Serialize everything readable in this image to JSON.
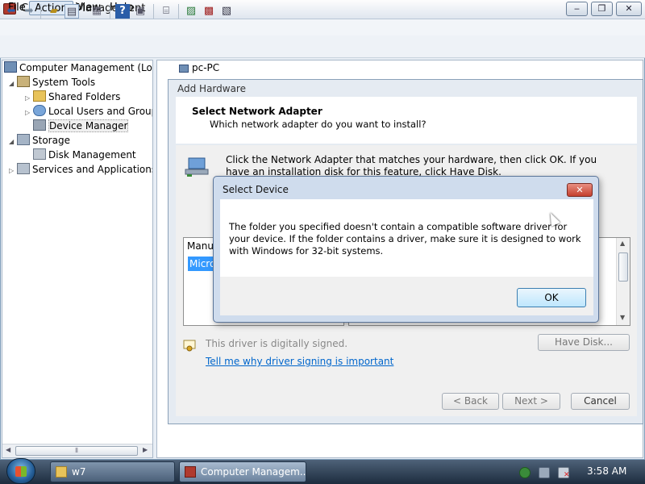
{
  "window": {
    "title": "Computer Management",
    "controls": {
      "minimize": "‒",
      "maximize": "❐",
      "close": "✕"
    }
  },
  "menu": {
    "file": "File",
    "action": "Action",
    "view": "View",
    "help": "Help"
  },
  "toolbar": {
    "icons": [
      "back-arrow-icon",
      "forward-arrow-icon",
      "up-folder-icon",
      "show-hide-tree-icon",
      "export-list-icon",
      "help-icon",
      "properties-icon",
      "scan-hardware-icon",
      "update-driver-icon",
      "disable-device-icon",
      "uninstall-device-icon"
    ]
  },
  "tree": {
    "root": "Computer Management (Local",
    "system_tools": "System Tools",
    "shared_folders": "Shared Folders",
    "local_users": "Local Users and Groups",
    "device_manager": "Device Manager",
    "storage": "Storage",
    "disk_management": "Disk Management",
    "services": "Services and Applications"
  },
  "right_pane": {
    "computer": "pc-PC"
  },
  "wizard": {
    "title": "Add Hardware",
    "header_title": "Select Network Adapter",
    "header_subtitle": "Which network adapter do you want to install?",
    "instructions": "Click the Network Adapter that matches your hardware, then click OK. If you have an installation disk for this feature, click Have Disk.",
    "list_header": "Manu",
    "list_selected": "Micro",
    "signed_text": "This driver is digitally signed.",
    "signing_link": "Tell me why driver signing is important",
    "have_disk": "Have Disk...",
    "back": "< Back",
    "next": "Next >",
    "cancel": "Cancel"
  },
  "dialog": {
    "title": "Select Device",
    "close": "✕",
    "message": "The folder you specified doesn't contain a compatible software driver for your device. If the folder contains a driver, make sure it is designed to work with Windows for 32-bit systems.",
    "ok": "OK"
  },
  "taskbar": {
    "items": [
      {
        "label": "w7"
      },
      {
        "label": "Computer Managem..."
      }
    ],
    "clock": "3:58 AM"
  }
}
